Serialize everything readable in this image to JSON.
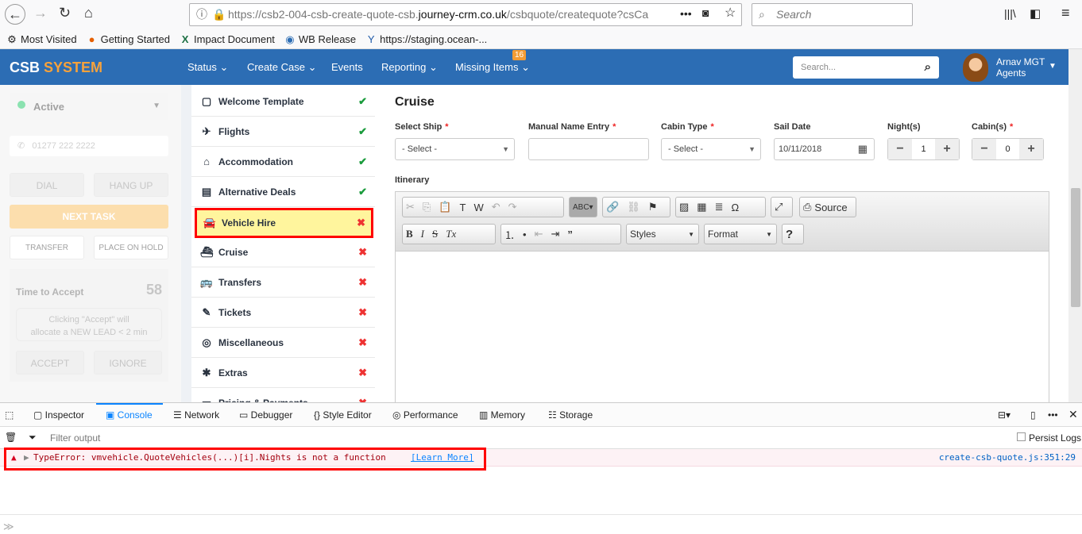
{
  "browser": {
    "url_prefix": "https://csb2-004-csb-create-quote-csb.",
    "url_domain": "journey-crm.co.uk",
    "url_suffix": "/csbquote/createquote?csCa",
    "search_placeholder": "Search",
    "bookmarks": [
      {
        "label": "Most Visited",
        "icon": "gear-icon"
      },
      {
        "label": "Getting Started",
        "icon": "firefox-icon"
      },
      {
        "label": "Impact Document",
        "icon": "excel-icon"
      },
      {
        "label": "WB Release",
        "icon": "send-icon"
      },
      {
        "label": "https://staging.ocean-...",
        "icon": "site-icon"
      }
    ]
  },
  "app": {
    "logo_a": "CSB",
    "logo_b": "SYSTEM",
    "nav": [
      "Status",
      "Create Case",
      "Events",
      "Reporting",
      "Missing Items"
    ],
    "missing_badge": "16",
    "search_placeholder": "Search...",
    "user": {
      "name": "Arnav MGT",
      "role": "Agents"
    },
    "brand_color": "#2c6db4",
    "accent_color": "#f7a23b"
  },
  "left": {
    "status": "Active",
    "phone": "01277 222 2222",
    "dial": "DIAL",
    "hangup": "HANG UP",
    "next": "NEXT TASK",
    "transfer": "TRANSFER",
    "hold": "PLACE ON HOLD",
    "time_label": "Time to Accept",
    "time_value": "58",
    "note1": "Clicking \"Accept\" will",
    "note2": "allocate a NEW LEAD < 2 min",
    "accept": "ACCEPT",
    "ignore": "IGNORE"
  },
  "sidebar": {
    "items": [
      {
        "label": "Welcome Template",
        "icon": "template-icon",
        "status": "done"
      },
      {
        "label": "Flights",
        "icon": "plane-icon",
        "status": "done"
      },
      {
        "label": "Accommodation",
        "icon": "home-icon",
        "status": "done"
      },
      {
        "label": "Alternative Deals",
        "icon": "newspaper-icon",
        "status": "done"
      },
      {
        "label": "Vehicle Hire",
        "icon": "car-icon",
        "status": "missing",
        "selected": true
      },
      {
        "label": "Cruise",
        "icon": "ship-icon",
        "status": "missing"
      },
      {
        "label": "Transfers",
        "icon": "bus-icon",
        "status": "missing"
      },
      {
        "label": "Tickets",
        "icon": "ticket-icon",
        "status": "missing"
      },
      {
        "label": "Miscellaneous",
        "icon": "target-icon",
        "status": "missing"
      },
      {
        "label": "Extras",
        "icon": "asterisk-icon",
        "status": "missing"
      },
      {
        "label": "Pricing & Payments",
        "icon": "card-icon",
        "status": "missing"
      }
    ]
  },
  "main": {
    "title": "Cruise",
    "select_ship": "Select Ship",
    "manual_name": "Manual Name Entry",
    "cabin_type": "Cabin Type",
    "sail_date": "Sail Date",
    "nights": "Night(s)",
    "cabins": "Cabin(s)",
    "select_placeholder": "- Select -",
    "sail_date_value": "10/11/2018",
    "nights_value": "1",
    "cabins_value": "0",
    "itinerary": "Itinerary",
    "source": "Source",
    "styles": "Styles",
    "format": "Format"
  },
  "devtools": {
    "tabs": [
      "Inspector",
      "Console",
      "Network",
      "Debugger",
      "Style Editor",
      "Performance",
      "Memory",
      "Storage"
    ],
    "active": "Console",
    "filter_placeholder": "Filter output",
    "persist": "Persist Logs",
    "error": "TypeError: vmvehicle.QuoteVehicles(...)[i].Nights is not a function",
    "learn_more": "[Learn More]",
    "source": "create-csb-quote.js:351:29"
  }
}
